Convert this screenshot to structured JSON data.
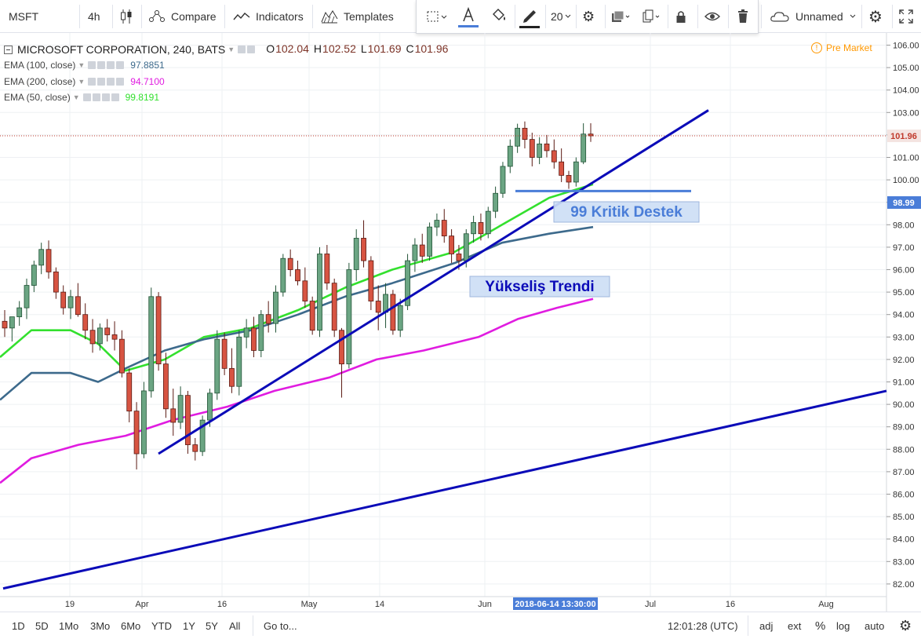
{
  "toolbar": {
    "symbol": "MSFT",
    "interval": "4h",
    "compare_label": "Compare",
    "indicators_label": "Indicators",
    "templates_label": "Templates",
    "font_size": "20",
    "layout_name": "Unnamed"
  },
  "legend": {
    "title": "MICROSOFT CORPORATION, 240, BATS",
    "ohlc": [
      {
        "k": "O",
        "v": "102.04"
      },
      {
        "k": "H",
        "v": "102.52"
      },
      {
        "k": "L",
        "v": "101.69"
      },
      {
        "k": "C",
        "v": "101.96"
      }
    ],
    "emas": [
      {
        "name": "EMA (100, close)",
        "value": "97.8851",
        "color": "#3d6a8c"
      },
      {
        "name": "EMA (200, close)",
        "value": "94.7100",
        "color": "#e01ce0"
      },
      {
        "name": "EMA (50, close)",
        "value": "99.8191",
        "color": "#33e02e"
      }
    ],
    "premarket": "Pre Market"
  },
  "annotations": {
    "support": "99 Kritik Destek",
    "trend": "Yükseliş Trendi"
  },
  "chart_data": {
    "type": "candlestick",
    "ylim": [
      81.6,
      106.7
    ],
    "y_ticks": [
      "106.00",
      "105.00",
      "104.00",
      "103.00",
      "102.00",
      "101.00",
      "100.00",
      "99.00",
      "98.00",
      "97.00",
      "96.00",
      "95.00",
      "94.00",
      "93.00",
      "92.00",
      "91.00",
      "90.00",
      "89.00",
      "88.00",
      "87.00",
      "86.00",
      "85.00",
      "84.00",
      "83.00",
      "82.00"
    ],
    "x_ticks": [
      "19",
      "Apr",
      "16",
      "May",
      "14",
      "Jun",
      "Jul",
      "16",
      "Aug"
    ],
    "last_price": {
      "label": "101.96",
      "value": 101.96,
      "color": "#c0392b"
    },
    "support_label": {
      "label": "98.99",
      "value": 98.99,
      "color": "#4a7dd8"
    },
    "crosshair_time": "2018-06-14 13:30:00",
    "support_level": 99.5,
    "trendlines": [
      {
        "from": [
          "Apr 3",
          87.8
        ],
        "to": [
          "Jun 29",
          103.1
        ],
        "color": "#0b0bb8"
      },
      {
        "from": [
          "Mar 14",
          81.8
        ],
        "to": [
          "Aug 10",
          90.6
        ],
        "color": "#0b0bb8"
      }
    ],
    "series": [
      {
        "name": "EMA (50, close)",
        "color": "#33e02e",
        "values": [
          92.1,
          93.3,
          93.3,
          92.7,
          91.5,
          92.0,
          93.0,
          93.4,
          94.2,
          95.2,
          96.0,
          96.8,
          98.0,
          99.2,
          99.8
        ]
      },
      {
        "name": "EMA (100, close)",
        "color": "#3d6a8c",
        "values": [
          90.2,
          91.4,
          91.4,
          91.0,
          91.6,
          92.4,
          92.9,
          93.3,
          94.0,
          94.8,
          95.4,
          96.3,
          97.2,
          97.6,
          97.9
        ]
      },
      {
        "name": "EMA (200, close)",
        "color": "#e01ce0",
        "values": [
          86.5,
          87.6,
          88.2,
          88.6,
          89.3,
          89.9,
          90.6,
          91.2,
          92.0,
          92.4,
          93.0,
          93.8,
          94.3,
          94.7
        ]
      }
    ],
    "candles": [
      [
        93.7,
        94.2,
        93.0,
        93.4
      ],
      [
        93.4,
        93.9,
        92.8,
        93.9
      ],
      [
        93.9,
        94.6,
        93.5,
        94.3
      ],
      [
        94.3,
        95.6,
        93.8,
        95.3
      ],
      [
        95.3,
        96.4,
        95.0,
        96.2
      ],
      [
        96.2,
        97.2,
        95.8,
        96.9
      ],
      [
        96.9,
        97.3,
        95.6,
        95.9
      ],
      [
        95.9,
        96.1,
        94.7,
        95.0
      ],
      [
        95.0,
        95.3,
        94.0,
        94.3
      ],
      [
        94.3,
        95.1,
        93.8,
        94.8
      ],
      [
        94.8,
        95.4,
        93.9,
        94.0
      ],
      [
        94.0,
        94.5,
        92.9,
        93.3
      ],
      [
        93.3,
        93.8,
        92.3,
        92.7
      ],
      [
        92.7,
        93.6,
        92.4,
        93.4
      ],
      [
        93.4,
        93.8,
        92.8,
        93.1
      ],
      [
        93.1,
        93.7,
        92.4,
        92.9
      ],
      [
        92.9,
        93.3,
        91.2,
        91.4
      ],
      [
        91.4,
        91.6,
        89.2,
        89.7
      ],
      [
        89.7,
        90.1,
        87.1,
        87.8
      ],
      [
        87.8,
        91.0,
        87.6,
        90.6
      ],
      [
        90.6,
        95.2,
        90.3,
        94.8
      ],
      [
        94.8,
        95.0,
        91.5,
        91.8
      ],
      [
        91.8,
        92.3,
        89.4,
        89.8
      ],
      [
        89.8,
        90.7,
        88.6,
        89.2
      ],
      [
        89.2,
        90.8,
        88.9,
        90.4
      ],
      [
        90.4,
        90.6,
        87.8,
        88.2
      ],
      [
        88.2,
        88.5,
        87.5,
        87.9
      ],
      [
        87.9,
        89.5,
        87.7,
        89.3
      ],
      [
        89.3,
        90.7,
        89.0,
        90.5
      ],
      [
        90.5,
        93.3,
        90.2,
        92.9
      ],
      [
        92.9,
        93.2,
        91.3,
        91.6
      ],
      [
        91.6,
        92.5,
        90.5,
        90.8
      ],
      [
        90.8,
        93.3,
        90.4,
        93.0
      ],
      [
        93.0,
        93.8,
        92.5,
        93.4
      ],
      [
        93.4,
        93.9,
        92.1,
        92.4
      ],
      [
        92.4,
        94.2,
        92.1,
        94.0
      ],
      [
        94.0,
        94.6,
        93.2,
        93.6
      ],
      [
        93.6,
        95.3,
        93.2,
        95.0
      ],
      [
        95.0,
        96.7,
        94.8,
        96.5
      ],
      [
        96.5,
        96.9,
        95.7,
        96.0
      ],
      [
        96.0,
        96.4,
        95.3,
        95.5
      ],
      [
        95.5,
        96.1,
        94.3,
        94.6
      ],
      [
        94.6,
        94.8,
        93.1,
        93.3
      ],
      [
        93.3,
        97.0,
        93.0,
        96.7
      ],
      [
        96.7,
        97.1,
        95.1,
        95.4
      ],
      [
        95.4,
        95.6,
        93.0,
        93.3
      ],
      [
        93.3,
        93.4,
        90.3,
        91.8
      ],
      [
        91.8,
        96.3,
        91.6,
        96.0
      ],
      [
        96.0,
        97.8,
        95.5,
        97.4
      ],
      [
        97.4,
        98.2,
        96.1,
        96.4
      ],
      [
        96.4,
        96.6,
        94.2,
        94.6
      ],
      [
        94.6,
        95.3,
        93.3,
        94.1
      ],
      [
        94.1,
        95.4,
        93.4,
        94.9
      ],
      [
        94.9,
        95.1,
        93.1,
        93.3
      ],
      [
        93.3,
        94.7,
        93.0,
        94.4
      ],
      [
        94.4,
        96.7,
        94.2,
        96.4
      ],
      [
        96.4,
        97.4,
        95.9,
        97.1
      ],
      [
        97.1,
        97.6,
        96.3,
        96.6
      ],
      [
        96.6,
        98.1,
        96.4,
        97.9
      ],
      [
        97.9,
        98.5,
        97.5,
        98.2
      ],
      [
        98.2,
        98.7,
        97.2,
        97.5
      ],
      [
        97.5,
        97.8,
        96.3,
        96.7
      ],
      [
        96.7,
        97.1,
        96.0,
        96.4
      ],
      [
        96.4,
        97.8,
        96.1,
        97.6
      ],
      [
        97.6,
        98.4,
        97.2,
        98.1
      ],
      [
        98.1,
        98.5,
        97.3,
        97.6
      ],
      [
        97.6,
        98.8,
        97.4,
        98.6
      ],
      [
        98.6,
        99.7,
        98.3,
        99.4
      ],
      [
        99.4,
        100.8,
        99.2,
        100.6
      ],
      [
        100.6,
        101.8,
        100.3,
        101.5
      ],
      [
        101.5,
        102.5,
        101.2,
        102.3
      ],
      [
        102.3,
        102.6,
        101.4,
        101.8
      ],
      [
        101.8,
        102.1,
        100.6,
        101.0
      ],
      [
        101.0,
        101.9,
        100.7,
        101.6
      ],
      [
        101.6,
        102.0,
        101.0,
        101.3
      ],
      [
        101.3,
        101.8,
        100.5,
        100.8
      ],
      [
        100.8,
        101.4,
        99.9,
        100.2
      ],
      [
        100.2,
        100.4,
        99.6,
        99.9
      ],
      [
        99.9,
        101.0,
        99.7,
        100.8
      ],
      [
        100.8,
        102.52,
        100.7,
        102.04
      ],
      [
        102.04,
        102.52,
        101.69,
        101.96
      ]
    ]
  },
  "bottom": {
    "ranges": [
      "1D",
      "5D",
      "1Mo",
      "3Mo",
      "6Mo",
      "YTD",
      "1Y",
      "5Y",
      "All"
    ],
    "goto": "Go to...",
    "time": "12:01:28 (UTC)",
    "opts": [
      "adj",
      "ext",
      "%",
      "log",
      "auto"
    ]
  }
}
